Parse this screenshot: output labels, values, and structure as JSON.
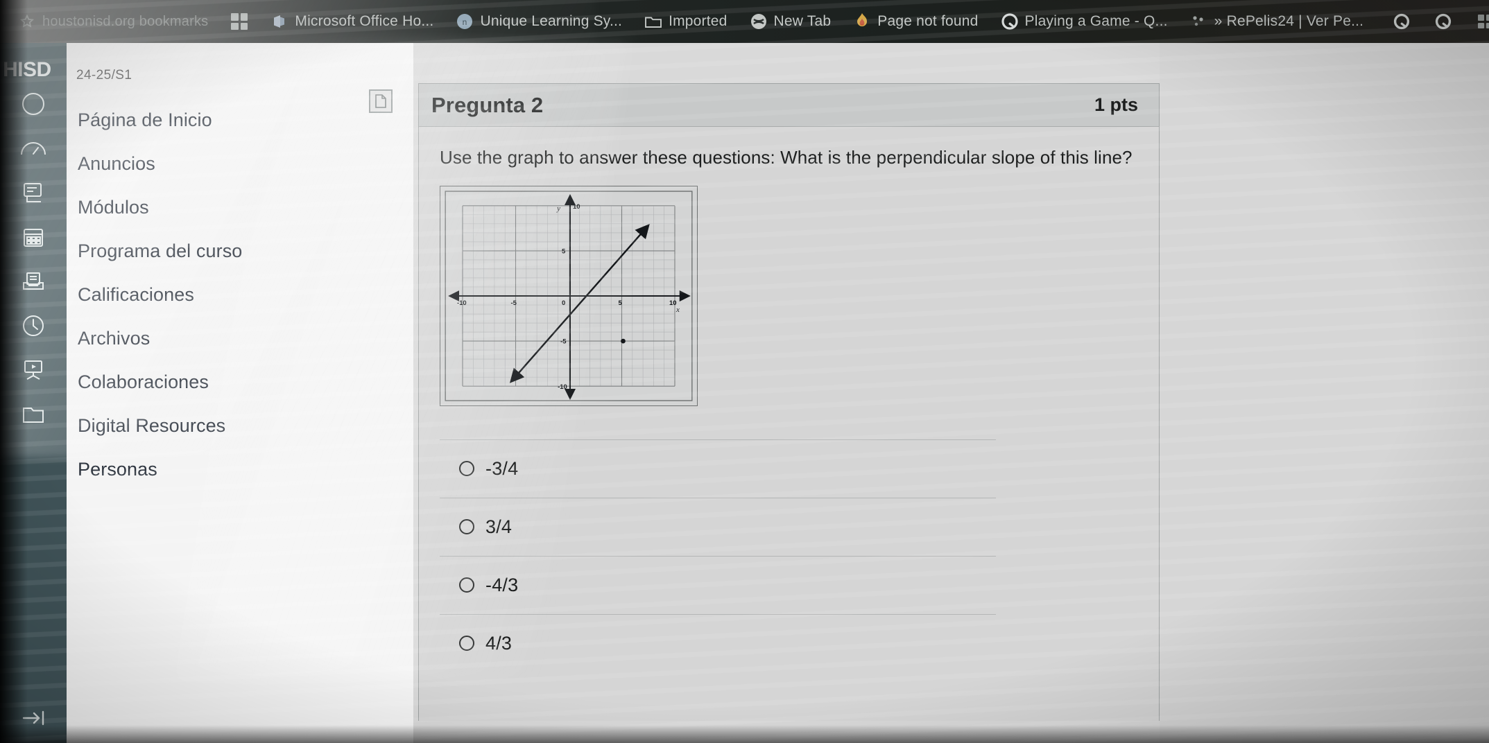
{
  "browser": {
    "bookmarks_label": "houstonisd.org bookmarks",
    "tabs": [
      {
        "label": "Microsoft Office Ho...",
        "icon": "office-icon"
      },
      {
        "label": "Unique Learning Sy...",
        "icon": "unique-learning-icon"
      },
      {
        "label": "Imported",
        "icon": "folder-icon"
      },
      {
        "label": "New Tab",
        "icon": "globe-icon"
      },
      {
        "label": "Page not found",
        "icon": "flame-icon"
      },
      {
        "label": "Playing a Game - Q...",
        "icon": "quizizz-icon"
      },
      {
        "label": "» RePelis24 | Ver Pe...",
        "icon": "dots-icon"
      }
    ],
    "trailing_icons": [
      "quizizz-icon",
      "quizizz-icon",
      "grid-icon"
    ]
  },
  "rail": {
    "logo": "HISD",
    "items": [
      {
        "name": "account-icon"
      },
      {
        "name": "dashboard-icon"
      },
      {
        "name": "courses-icon"
      },
      {
        "name": "calendar-icon"
      },
      {
        "name": "inbox-icon"
      },
      {
        "name": "history-icon"
      },
      {
        "name": "studio-icon"
      },
      {
        "name": "resources-icon"
      }
    ],
    "collapse_icon": "arrow-to-right-icon"
  },
  "course_nav": {
    "term": "24-25/S1",
    "items": [
      {
        "label": "Página de Inicio"
      },
      {
        "label": "Anuncios"
      },
      {
        "label": "Módulos"
      },
      {
        "label": "Programa del curso"
      },
      {
        "label": "Calificaciones"
      },
      {
        "label": "Archivos"
      },
      {
        "label": "Colaboraciones"
      },
      {
        "label": "Digital Resources"
      },
      {
        "label": "Personas"
      }
    ]
  },
  "question": {
    "title": "Pregunta 2",
    "points": "1 pts",
    "prompt": "Use the graph to answer these questions: What is the perpendicular slope of this line?",
    "answers": [
      {
        "label": "-3/4",
        "selected": false
      },
      {
        "label": "3/4",
        "selected": false
      },
      {
        "label": "-4/3",
        "selected": false
      },
      {
        "label": "4/3",
        "selected": false
      }
    ]
  },
  "chart_data": {
    "type": "line",
    "title": "",
    "xlabel": "x",
    "ylabel": "y",
    "xlim": [
      -10,
      10
    ],
    "ylim": [
      -10,
      10
    ],
    "xticks": [
      -10,
      -5,
      0,
      5,
      10
    ],
    "yticks": [
      -10,
      -5,
      0,
      5,
      10
    ],
    "xtick_labels": [
      "-10",
      "-5",
      "0",
      "5",
      "10"
    ],
    "ytick_labels": [
      "-10",
      "-5",
      "",
      "5",
      "10"
    ],
    "grid": true,
    "grid_minor_step": 1,
    "grid_major_step": 5,
    "axes_arrows": true,
    "series": [
      {
        "name": "line",
        "type": "line",
        "slope": 1.3333,
        "intercept": -2,
        "equation": "y = 4/3 x - 2",
        "points": [
          [
            -5.2,
            -9.0
          ],
          [
            7.0,
            7.3
          ]
        ],
        "arrow_both_ends": true
      },
      {
        "name": "marked-point",
        "type": "scatter",
        "points": [
          [
            5,
            -5
          ]
        ]
      }
    ],
    "legend": null
  },
  "colors": {
    "rail_bg": "#3f5257",
    "nav_bg": "#f4f4f4",
    "card_bg": "#d5d5d5",
    "card_header_bg": "#c7c9c9",
    "text": "#1d1f1f",
    "tab_text": "#cfd3d1"
  }
}
